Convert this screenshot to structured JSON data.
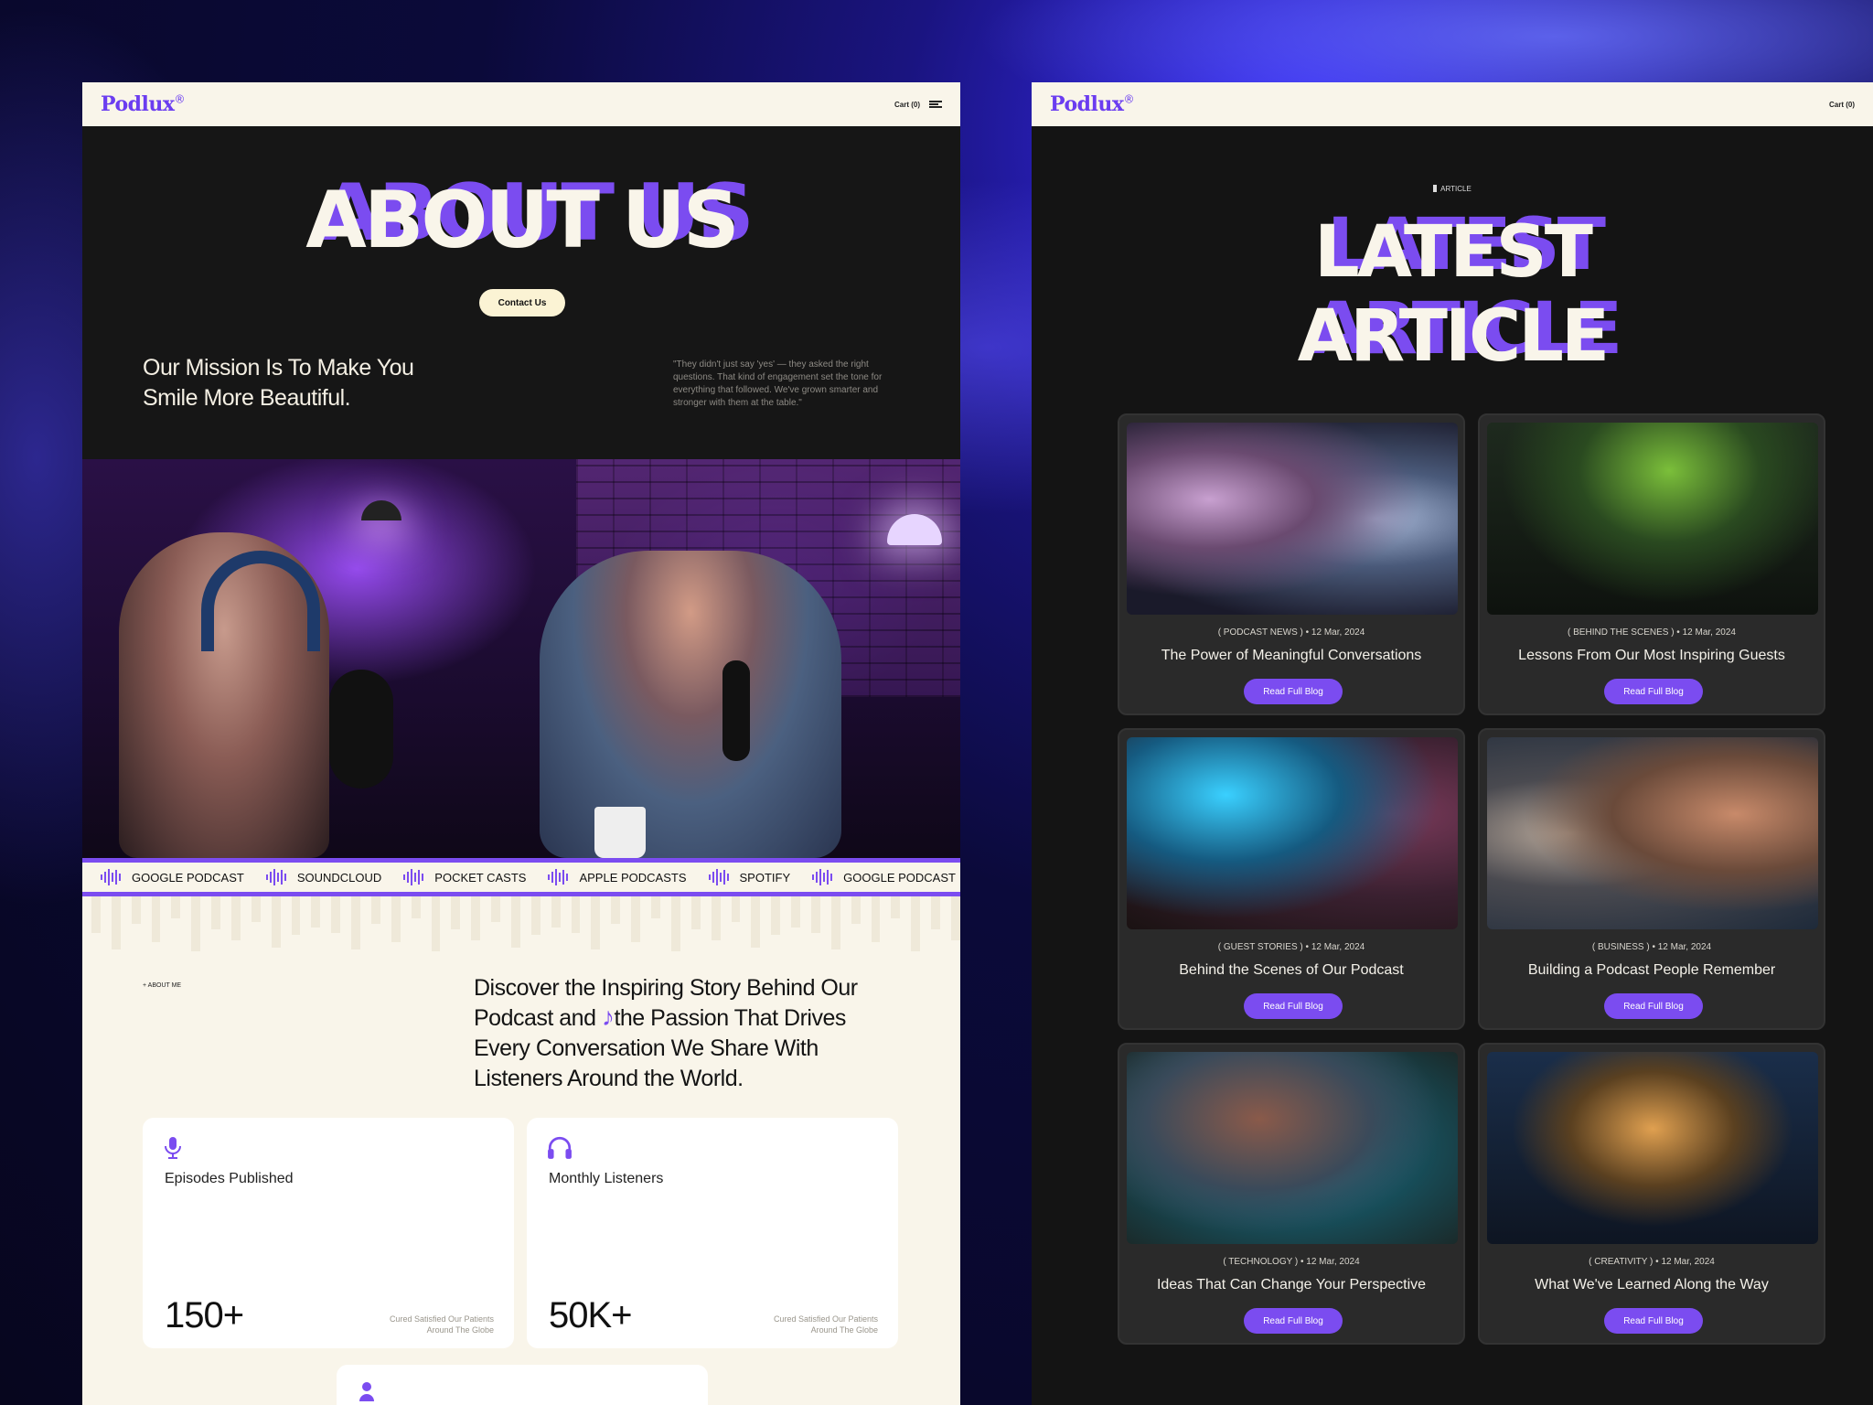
{
  "about_page": {
    "logo": "Podlux",
    "logo_mark": "®",
    "cart": "Cart (0)",
    "title": "ABOUT US",
    "contact_button": "Contact Us",
    "mission": "Our Mission Is To Make You Smile More Beautiful.",
    "quote": "\"They didn't just say 'yes' — they asked the right questions. That kind of engagement set the tone for everything that followed. We've grown smarter and stronger with them at the table.\"",
    "platforms": [
      "GOOGLE PODCAST",
      "SOUNDCLOUD",
      "POCKET CASTS",
      "APPLE PODCASTS",
      "SPOTIFY",
      "GOOGLE PODCAST"
    ],
    "about_tag": "ABOUT ME",
    "discover_1": "Discover the Inspiring Story Behind Our Podcast and",
    "discover_2": "the Passion That Drives Every Conversation We Share With Listeners Around the World.",
    "stats": [
      {
        "icon": "microphone-icon",
        "label": "Episodes Published",
        "value": "150+",
        "note": "Cured Satisfied Our Patients Around The Globe"
      },
      {
        "icon": "headphones-icon",
        "label": "Monthly Listeners",
        "value": "50K+",
        "note": "Cured Satisfied Our Patients Around The Globe"
      }
    ]
  },
  "articles_page": {
    "logo": "Podlux",
    "logo_mark": "®",
    "cart": "Cart (0)",
    "tag": "ARTICLE",
    "title_1": "LATEST",
    "title_2": "ARTICLE",
    "articles": [
      {
        "category": "( PODCAST NEWS )",
        "date": "12 Mar, 2024",
        "title": "The Power of Meaningful Conversations",
        "button": "Read Full Blog"
      },
      {
        "category": "( BEHIND THE SCENES )",
        "date": "12 Mar, 2024",
        "title": "Lessons From Our Most Inspiring Guests",
        "button": "Read Full Blog"
      },
      {
        "category": "( GUEST STORIES )",
        "date": "12 Mar, 2024",
        "title": "Behind the Scenes of Our Podcast",
        "button": "Read Full Blog"
      },
      {
        "category": "( BUSINESS )",
        "date": "12 Mar, 2024",
        "title": "Building a Podcast People Remember",
        "button": "Read Full Blog"
      },
      {
        "category": "( TECHNOLOGY )",
        "date": "12 Mar, 2024",
        "title": "Ideas That Can Change Your Perspective",
        "button": "Read Full Blog"
      },
      {
        "category": "( CREATIVITY )",
        "date": "12 Mar, 2024",
        "title": "What We've Learned Along the Way",
        "button": "Read Full Blog"
      }
    ]
  },
  "colors": {
    "accent": "#7b4cf0",
    "cream": "#f9f5ea",
    "dark": "#161616"
  }
}
